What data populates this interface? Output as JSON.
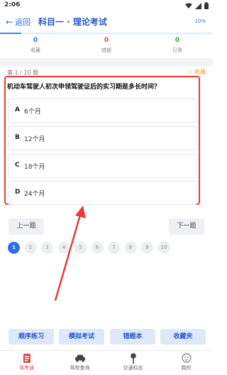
{
  "status_bar": {
    "time": "2:06"
  },
  "header": {
    "back_label": "返回",
    "title": "科目一 · 理论考试",
    "progress_text": "10%",
    "progress_fraction": 0.1
  },
  "stats": [
    {
      "value": "0",
      "label": "收藏"
    },
    {
      "value": "0",
      "label": "错题"
    },
    {
      "value": "0",
      "label": "已答"
    }
  ],
  "question": {
    "number": "第 1 / 10 题",
    "favorite_label": "☆ 收藏",
    "text": "机动车驾驶人初次申领驾驶证后的实习期是多长时间？",
    "options": [
      {
        "letter": "A",
        "text": "6个月"
      },
      {
        "letter": "B",
        "text": "12个月"
      },
      {
        "letter": "C",
        "text": "18个月"
      },
      {
        "letter": "D",
        "text": "24个月"
      }
    ]
  },
  "nav": {
    "prev_label": "上一题",
    "next_label": "下一题"
  },
  "pager": {
    "pages": [
      "1",
      "2",
      "3",
      "4",
      "5",
      "6",
      "7",
      "8",
      "9",
      "10"
    ],
    "current": "1"
  },
  "modes": [
    "顺序练习",
    "模拟考试",
    "错题本",
    "收藏夹"
  ],
  "tabs": [
    {
      "label": "驾考通",
      "icon": "exam-doc-icon"
    },
    {
      "label": "驾校查询",
      "icon": "car-icon"
    },
    {
      "label": "交通标志",
      "icon": "sign-post-icon"
    },
    {
      "label": "我的",
      "icon": "profile-icon"
    }
  ],
  "colors": {
    "accent": "#2f6fe0",
    "annotation_red": "#e53b3b",
    "mode_button_bg": "#dde8fb"
  }
}
